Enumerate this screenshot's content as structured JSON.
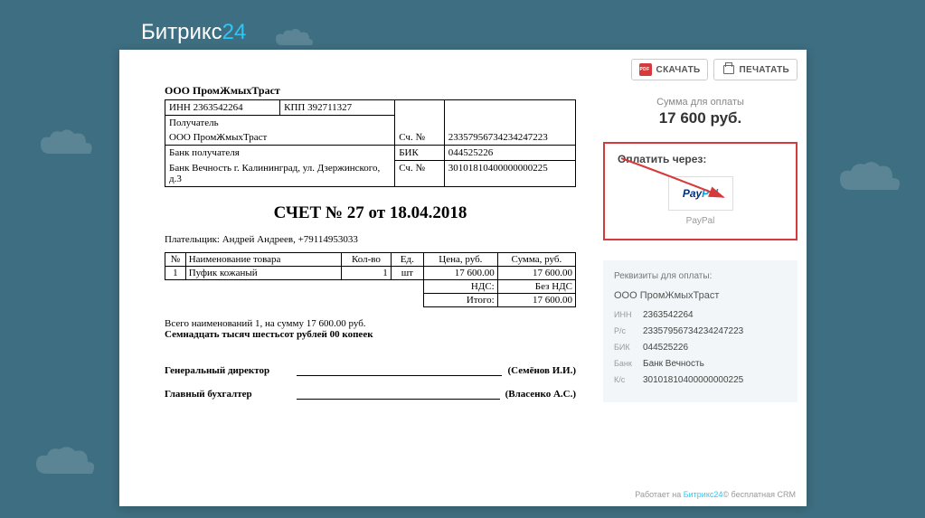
{
  "brand": {
    "name": "Битрикс",
    "suffix": "24"
  },
  "toolbar": {
    "download": "СКАЧАТЬ",
    "print": "ПЕЧАТАТЬ"
  },
  "payment_summary": {
    "label": "Сумма для оплаты",
    "amount": "17 600 руб."
  },
  "pay_via": {
    "title": "Оплатить через:",
    "method_caption": "PayPal"
  },
  "requisites": {
    "title": "Реквизиты для оплаты:",
    "company": "ООО ПромЖмыхТраст",
    "rows": [
      {
        "label": "ИНН",
        "value": "2363542264"
      },
      {
        "label": "Р/с",
        "value": "23357956734234247223"
      },
      {
        "label": "БИК",
        "value": "044525226"
      },
      {
        "label": "Банк",
        "value": "Банк Вечность"
      },
      {
        "label": "К/с",
        "value": "30101810400000000225"
      }
    ]
  },
  "footer": {
    "prefix": "Работает на ",
    "link": "Битрикс24",
    "suffix": " бесплатная CRM"
  },
  "invoice": {
    "company": "ООО ПромЖмыхТраст",
    "details": {
      "inn_label": "ИНН 2363542264",
      "kpp_label": "КПП 392711327",
      "receiver_label": "Получатель",
      "receiver_name": "ООО ПромЖмыхТраст",
      "acc_label": "Сч. №",
      "acc_value": "23357956734234247223",
      "bank_label": "Банк получателя",
      "bank_name": "Банк Вечность г. Калининград, ул. Дзержинского, д.3",
      "bik_label": "БИК",
      "bik_value": "044525226",
      "bank_acc_label": "Сч. №",
      "bank_acc_value": "30101810400000000225"
    },
    "title": "СЧЕТ № 27 от 18.04.2018",
    "payer": "Плательщик: Андрей Андреев, +79114953033",
    "table": {
      "headers": {
        "num": "№",
        "name": "Наименование товара",
        "qty": "Кол-во",
        "unit": "Ед.",
        "price": "Цена, руб.",
        "sum": "Сумма, руб."
      },
      "row": {
        "num": "1",
        "name": "Пуфик кожаный",
        "qty": "1",
        "unit": "шт",
        "price": "17 600.00",
        "sum": "17 600.00"
      },
      "vat_label": "НДС:",
      "vat_value": "Без НДС",
      "total_label": "Итого:",
      "total_value": "17 600.00"
    },
    "summary_line": "Всего наименований 1, на сумму 17 600.00 руб.",
    "summary_words": "Семнадцать тысяч шестьсот рублей 00 копеек",
    "sig_director_role": "Генеральный директор",
    "sig_director_name": "(Семёнов И.И.)",
    "sig_accountant_role": "Главный бухгалтер",
    "sig_accountant_name": "(Власенко А.С.)"
  }
}
